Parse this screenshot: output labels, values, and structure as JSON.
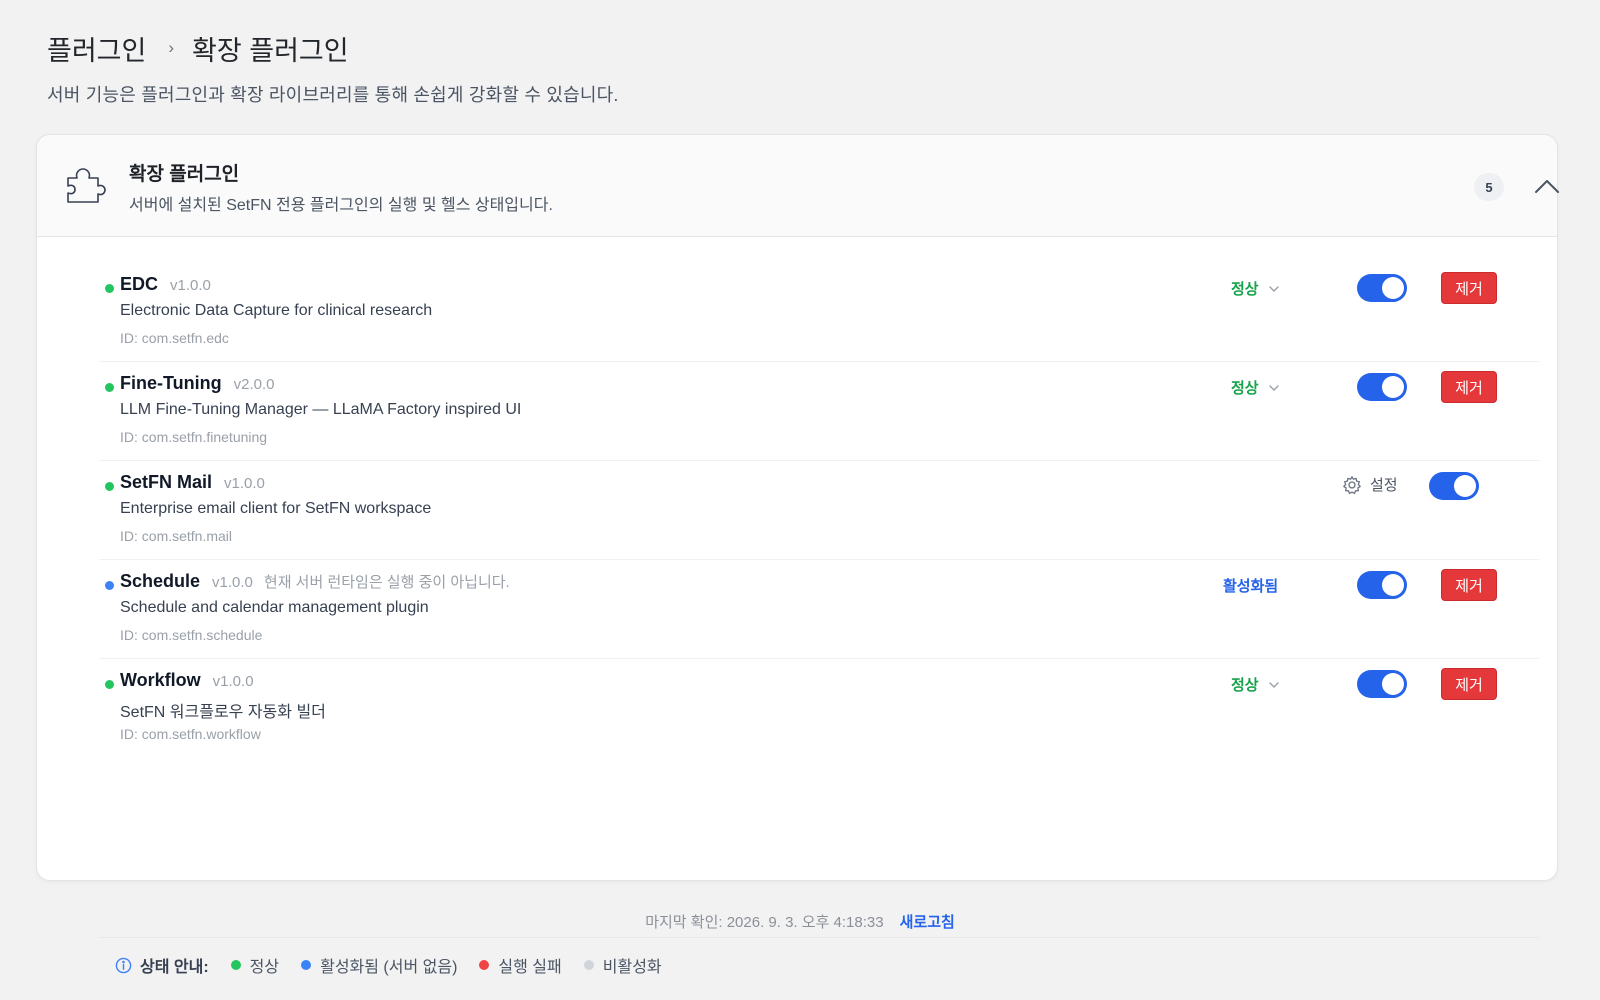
{
  "breadcrumb": {
    "parent": "플러그인",
    "separator": "›",
    "current": "확장 플러그인"
  },
  "page_subtitle": "서버 기능은 플러그인과 확장 라이브러리를 통해 손쉽게 강화할 수 있습니다.",
  "card": {
    "icon": "puzzle-icon",
    "title": "확장 플러그인",
    "description": "서버에 설치된 SetFN 전용 플러그인의 실행 및 헬스 상태입니다.",
    "count": "5",
    "collapse_icon": "chevron-up-icon"
  },
  "plugins": [
    {
      "name": "EDC",
      "version": "v1.0.0",
      "note": "",
      "description": "Electronic Data Capture for clinical research",
      "id": "ID: com.setfn.edc",
      "status": "정상",
      "status_color": "#16a34a",
      "dot_color": "#22c55e",
      "enabled": true,
      "action": "remove",
      "remove_label": "제거"
    },
    {
      "name": "Fine-Tuning",
      "version": "v2.0.0",
      "note": "",
      "description": "LLM Fine-Tuning Manager — LLaMA Factory inspired UI",
      "id": "ID: com.setfn.finetuning",
      "status": "정상",
      "status_color": "#16a34a",
      "dot_color": "#22c55e",
      "enabled": true,
      "action": "remove",
      "remove_label": "제거"
    },
    {
      "name": "SetFN Mail",
      "version": "v1.0.0",
      "note": "",
      "description": "Enterprise email client for SetFN workspace",
      "id": "ID: com.setfn.mail",
      "status": "",
      "dot_color": "#22c55e",
      "enabled": true,
      "action": "settings",
      "settings_label": "설정"
    },
    {
      "name": "Schedule",
      "version": "v1.0.0",
      "note": "현재 서버 런타임은 실행 중이 아닙니다.",
      "description": "Schedule and calendar management plugin",
      "id": "ID: com.setfn.schedule",
      "status": "활성화됨",
      "status_color": "#2563eb",
      "dot_color": "#3b82f6",
      "enabled": true,
      "action": "remove",
      "remove_label": "제거"
    },
    {
      "name": "Workflow",
      "version": "v1.0.0",
      "note": "",
      "description": "SetFN 워크플로우 자동화 빌더",
      "id": "ID: com.setfn.workflow",
      "status": "정상",
      "status_color": "#16a34a",
      "dot_color": "#22c55e",
      "enabled": true,
      "action": "remove",
      "remove_label": "제거"
    }
  ],
  "legend": {
    "label": "상태 안내:",
    "items": [
      {
        "label": "정상",
        "color": "#22c55e"
      },
      {
        "label": "활성화됨 (서버 없음)",
        "color": "#3b82f6"
      },
      {
        "label": "실행 실패",
        "color": "#ef4444"
      },
      {
        "label": "비활성화",
        "color": "#d1d5db"
      }
    ]
  },
  "footer": {
    "last_checked": "마지막 확인: 2026. 9. 3. 오후 4:18:33",
    "refresh_label": "새로고침"
  }
}
